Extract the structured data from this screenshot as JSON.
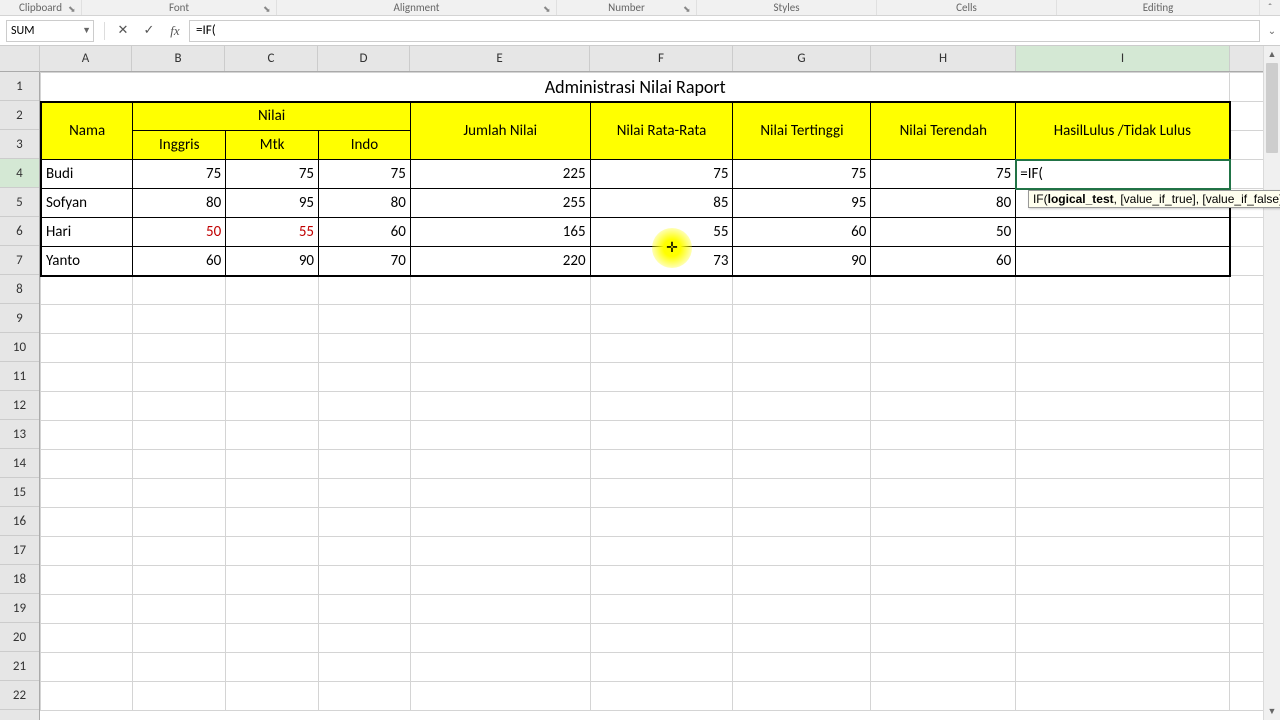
{
  "ribbon_groups": {
    "clipboard": "Clipboard",
    "font": "Font",
    "alignment": "Alignment",
    "number": "Number",
    "styles": "Styles",
    "cells": "Cells",
    "editing": "Editing"
  },
  "name_box": "SUM",
  "formula_bar": "=IF(",
  "columns": [
    "A",
    "B",
    "C",
    "D",
    "E",
    "F",
    "G",
    "H",
    "I"
  ],
  "rows": [
    "1",
    "2",
    "3",
    "4",
    "5",
    "6",
    "7",
    "8",
    "9",
    "10",
    "11",
    "12",
    "13",
    "14",
    "15",
    "16",
    "17",
    "18",
    "19",
    "20",
    "21",
    "22"
  ],
  "title": "Administrasi Nilai Raport",
  "headers": {
    "nama": "Nama",
    "nilai": "Nilai",
    "inggris": "Inggris",
    "mtk": "Mtk",
    "indo": "Indo",
    "jumlah": "Jumlah Nilai",
    "rata": "Nilai Rata-Rata",
    "tertinggi": "Nilai Tertinggi",
    "terendah": "Nilai Terendah",
    "hasil": "HasilLulus /Tidak Lulus"
  },
  "data": [
    {
      "nama": "Budi",
      "inggris": "75",
      "mtk": "75",
      "indo": "75",
      "jumlah": "225",
      "rata": "75",
      "tertinggi": "75",
      "terendah": "75",
      "hasil": "=IF("
    },
    {
      "nama": "Sofyan",
      "inggris": "80",
      "mtk": "95",
      "indo": "80",
      "jumlah": "255",
      "rata": "85",
      "tertinggi": "95",
      "terendah": "80",
      "hasil": ""
    },
    {
      "nama": "Hari",
      "inggris": "50",
      "mtk": "55",
      "indo": "60",
      "jumlah": "165",
      "rata": "55",
      "tertinggi": "60",
      "terendah": "50",
      "hasil": ""
    },
    {
      "nama": "Yanto",
      "inggris": "60",
      "mtk": "90",
      "indo": "70",
      "jumlah": "220",
      "rata": "73",
      "tertinggi": "90",
      "terendah": "60",
      "hasil": ""
    }
  ],
  "tooltip": {
    "fn": "IF(",
    "arg1": "logical_test",
    "rest": ", [value_if_true], [value_if_false])"
  },
  "active_cell": "I4",
  "chart_data": {
    "type": "table",
    "title": "Administrasi Nilai Raport",
    "columns": [
      "Nama",
      "Inggris",
      "Mtk",
      "Indo",
      "Jumlah Nilai",
      "Nilai Rata-Rata",
      "Nilai Tertinggi",
      "Nilai Terendah"
    ],
    "rows": [
      [
        "Budi",
        75,
        75,
        75,
        225,
        75,
        75,
        75
      ],
      [
        "Sofyan",
        80,
        95,
        80,
        255,
        85,
        95,
        80
      ],
      [
        "Hari",
        50,
        55,
        60,
        165,
        55,
        60,
        50
      ],
      [
        "Yanto",
        60,
        90,
        70,
        220,
        73,
        90,
        60
      ]
    ]
  }
}
